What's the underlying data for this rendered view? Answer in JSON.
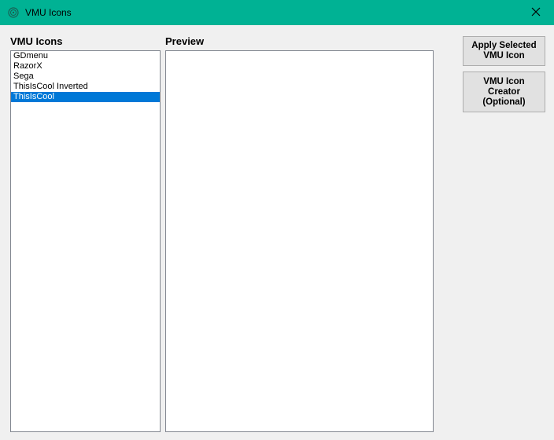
{
  "window": {
    "title": "VMU Icons",
    "app_icon": "vmu-app-icon",
    "close_icon": "close-icon"
  },
  "list": {
    "heading": "VMU Icons",
    "items": [
      "GDmenu",
      "RazorX",
      "Sega",
      "ThisIsCool Inverted",
      "ThisIsCool"
    ],
    "selected_index": 4
  },
  "preview": {
    "heading": "Preview"
  },
  "buttons": {
    "apply": [
      "Apply Selected",
      "VMU Icon"
    ],
    "creator": [
      "VMU Icon",
      "Creator",
      "(Optional)"
    ]
  },
  "colors": {
    "titlebar": "#00b294",
    "selection": "#0078d7"
  }
}
